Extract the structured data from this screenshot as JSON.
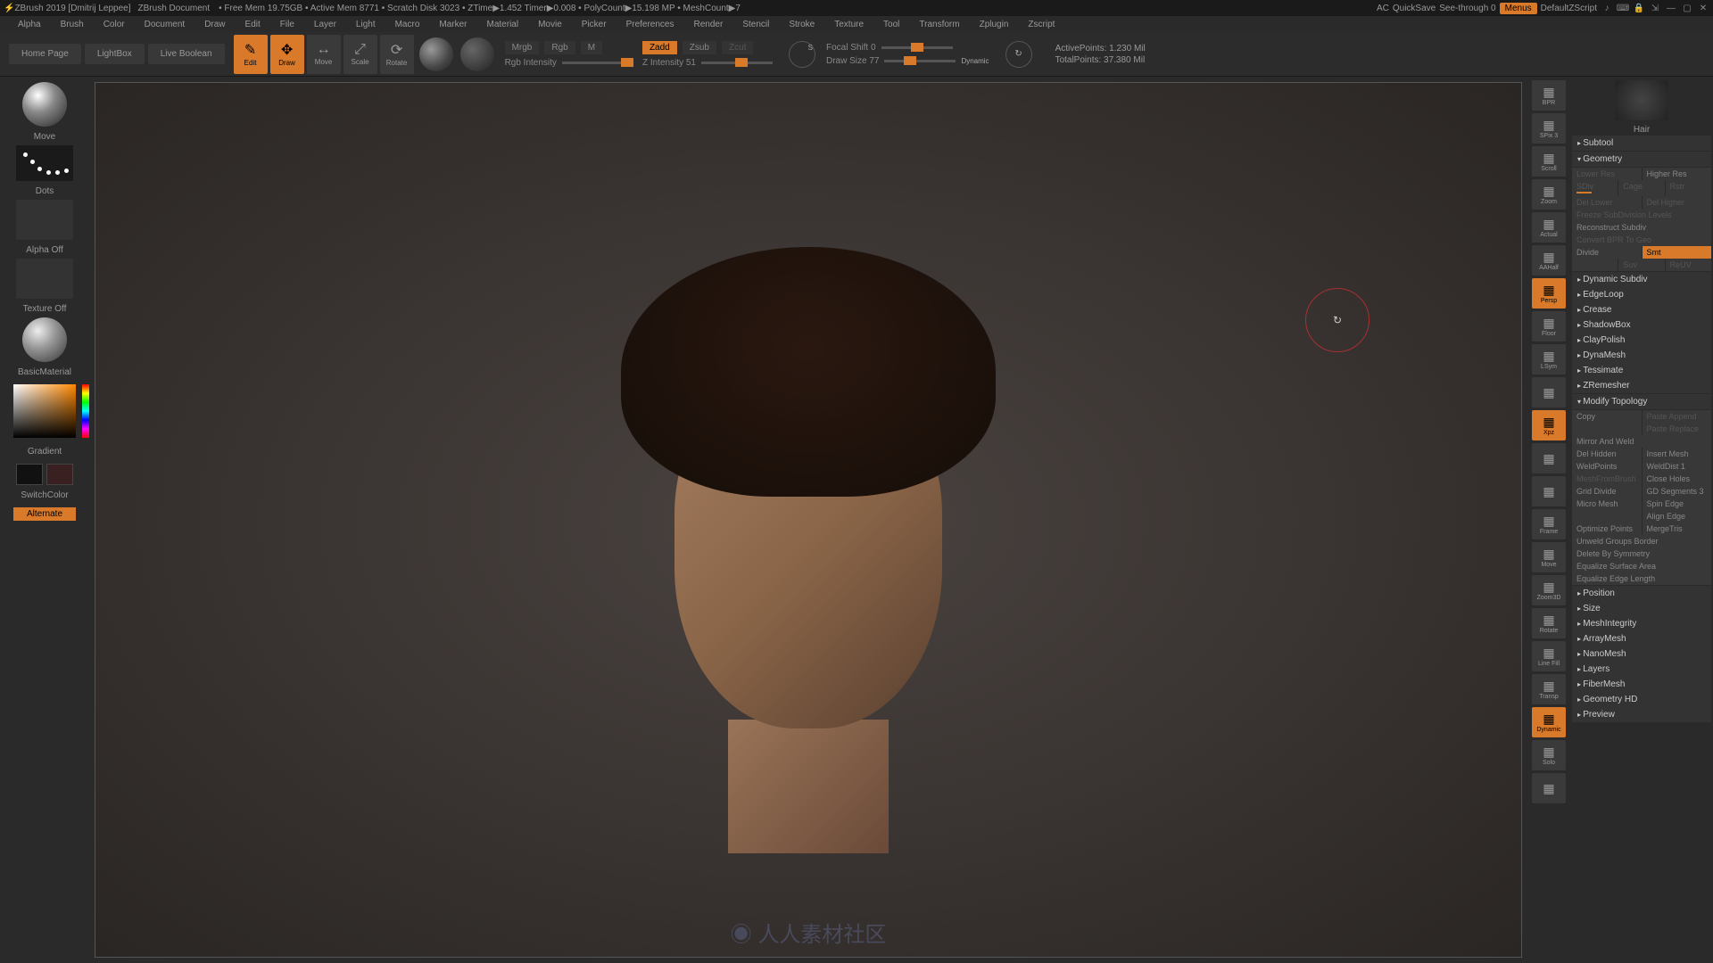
{
  "title_bar": {
    "app": "ZBrush 2019 [Dmitrij Leppee]",
    "doc": "ZBrush Document",
    "status": "• Free Mem 19.75GB • Active Mem 8771 • Scratch Disk 3023 • ZTime▶1.452 Timer▶0.008 • PolyCount▶15.198 MP • MeshCount▶7",
    "ac": "AC",
    "quicksave": "QuickSave",
    "seethrough": "See-through  0",
    "menus": "Menus",
    "default_zscript": "DefaultZScript"
  },
  "menus": [
    "Alpha",
    "Brush",
    "Color",
    "Document",
    "Draw",
    "Edit",
    "File",
    "Layer",
    "Light",
    "Macro",
    "Marker",
    "Material",
    "Movie",
    "Picker",
    "Preferences",
    "Render",
    "Stencil",
    "Stroke",
    "Texture",
    "Tool",
    "Transform",
    "Zplugin",
    "Zscript"
  ],
  "subbar": {
    "tabs": [
      "Home Page",
      "LightBox",
      "Live Boolean"
    ],
    "tools": [
      {
        "label": "Edit",
        "active": true
      },
      {
        "label": "Draw",
        "active": true
      },
      {
        "label": "Move",
        "active": false
      },
      {
        "label": "Scale",
        "active": false
      },
      {
        "label": "Rotate",
        "active": false
      }
    ],
    "modes": {
      "mrgb": "Mrgb",
      "rgb": "Rgb",
      "m": "M",
      "rgb_intensity": "Rgb Intensity"
    },
    "zmodes": {
      "zadd": "Zadd",
      "zsub": "Zsub",
      "zcut": "Zcut",
      "zint": "Z Intensity 51"
    },
    "focal": "Focal Shift 0",
    "drawsize": "Draw Size  77",
    "dynamic": "Dynamic",
    "active_pts": "ActivePoints: 1.230 Mil",
    "total_pts": "TotalPoints: 37.380 Mil"
  },
  "left": {
    "brush": "Move",
    "stroke": "Dots",
    "alpha": "Alpha Off",
    "texture": "Texture Off",
    "material": "BasicMaterial",
    "gradient": "Gradient",
    "switchcolor": "SwitchColor",
    "alternate": "Alternate"
  },
  "right_tools": [
    {
      "label": "BPR"
    },
    {
      "label": "SPix 3"
    },
    {
      "label": "Scroll"
    },
    {
      "label": "Zoom"
    },
    {
      "label": "Actual"
    },
    {
      "label": "AAHalf"
    },
    {
      "label": "Persp",
      "on": true
    },
    {
      "label": "Floor"
    },
    {
      "label": "LSym"
    },
    {
      "label": ""
    },
    {
      "label": "Xpz",
      "on": true
    },
    {
      "label": ""
    },
    {
      "label": ""
    },
    {
      "label": "Frame"
    },
    {
      "label": "Move"
    },
    {
      "label": "Zoom3D"
    },
    {
      "label": "Rotate"
    },
    {
      "label": "Line Fill"
    },
    {
      "label": "Transp"
    },
    {
      "label": "Dynamic",
      "on": true
    },
    {
      "label": "Solo"
    },
    {
      "label": ""
    }
  ],
  "rp": {
    "thumb_label": "Hair",
    "sections": [
      {
        "name": "Subtool",
        "open": false
      },
      {
        "name": "Geometry",
        "open": true
      }
    ],
    "geo_rows": [
      [
        {
          "t": "Lower Res",
          "dim": true
        },
        {
          "t": "Higher Res"
        }
      ],
      [
        {
          "t": "SDiv",
          "dim": true,
          "slider": true
        },
        {
          "t": "Cage",
          "dim": true
        },
        {
          "t": "Rstr",
          "dim": true
        }
      ],
      [
        {
          "t": "Del Lower",
          "dim": true
        },
        {
          "t": "Del Higher",
          "dim": true
        }
      ],
      [
        {
          "t": "Freeze SubDivision Levels",
          "dim": true
        }
      ],
      [
        {
          "t": "Reconstruct Subdiv"
        }
      ],
      [
        {
          "t": "Convert BPR To Geo",
          "dim": true
        }
      ],
      [
        {
          "t": "Divide"
        },
        {
          "t": "Smt",
          "orange": true
        }
      ],
      [
        {
          "t": ""
        },
        {
          "t": "Suv",
          "dim": true
        },
        {
          "t": "ReUV",
          "dim": true
        }
      ]
    ],
    "geo_heads": [
      "Dynamic Subdiv",
      "EdgeLoop",
      "Crease",
      "ShadowBox",
      "ClayPolish",
      "DynaMesh",
      "Tessimate",
      "ZRemesher"
    ],
    "mod_topo": "Modify Topology",
    "mod_rows": [
      [
        {
          "t": "Copy"
        },
        {
          "t": "Paste Append",
          "dim": true
        }
      ],
      [
        {
          "t": ""
        },
        {
          "t": "Paste Replace",
          "dim": true
        }
      ],
      [
        {
          "t": "Mirror And Weld"
        }
      ],
      [
        {
          "t": "Del Hidden"
        },
        {
          "t": "Insert Mesh"
        }
      ],
      [
        {
          "t": "WeldPoints"
        },
        {
          "t": "WeldDist 1"
        }
      ],
      [
        {
          "t": "MeshFromBrush",
          "dim": true
        },
        {
          "t": "Close Holes"
        }
      ],
      [
        {
          "t": "Grid Divide"
        },
        {
          "t": "GD Segments 3"
        }
      ],
      [
        {
          "t": "Micro Mesh"
        },
        {
          "t": "Spin Edge"
        }
      ],
      [
        {
          "t": ""
        },
        {
          "t": "Align Edge"
        }
      ],
      [
        {
          "t": "Optimize Points"
        },
        {
          "t": "MergeTris"
        }
      ],
      [
        {
          "t": "Unweld Groups Border"
        }
      ],
      [
        {
          "t": "Delete By Symmetry"
        }
      ],
      [
        {
          "t": "Equalize Surface Area"
        }
      ],
      [
        {
          "t": "Equalize Edge Length"
        }
      ]
    ],
    "tail_heads": [
      "Position",
      "Size",
      "MeshIntegrity",
      "ArrayMesh",
      "NanoMesh",
      "Layers",
      "FiberMesh",
      "Geometry HD",
      "Preview"
    ]
  }
}
